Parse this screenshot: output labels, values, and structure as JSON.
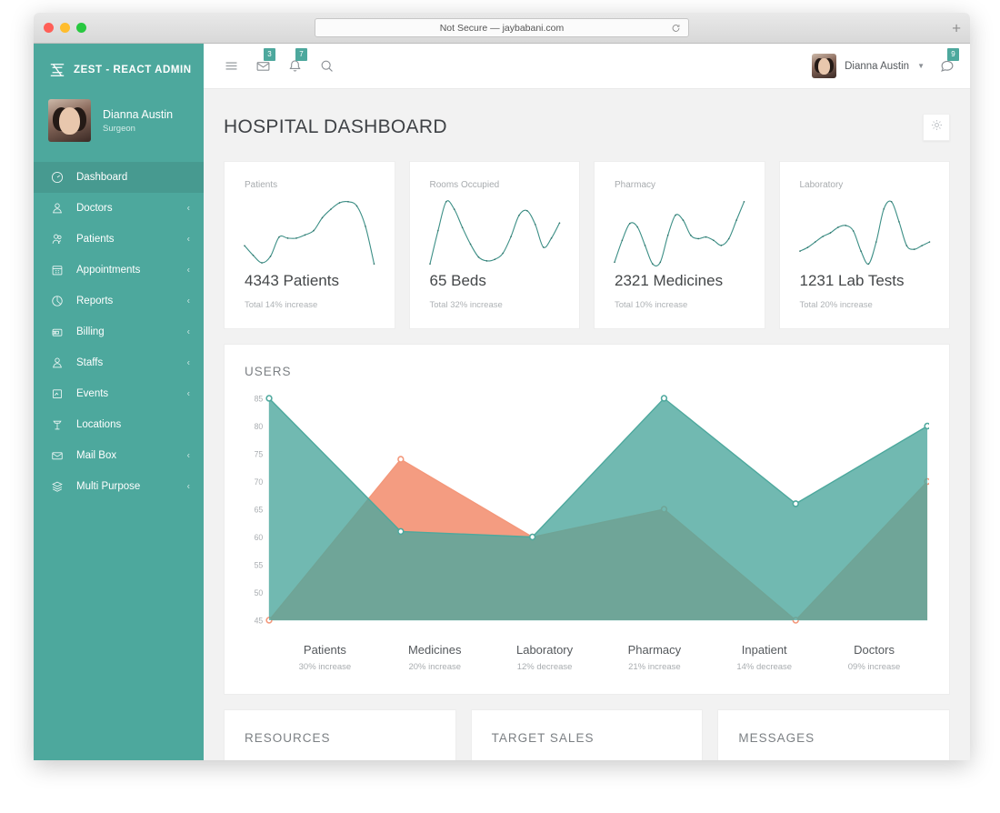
{
  "browser": {
    "url_text": "Not Secure — jaybabani.com",
    "reload_icon": "reload-icon",
    "newtab_label": "+"
  },
  "sidebar": {
    "brand": "ZEST - REACT ADMIN",
    "brand_logo_glyph": "Z",
    "profile": {
      "name": "Dianna Austin",
      "role": "Surgeon"
    },
    "items": [
      {
        "label": "Dashboard",
        "icon": "dashboard-icon",
        "active": true,
        "caret": ""
      },
      {
        "label": "Doctors",
        "icon": "doctor-icon",
        "active": false,
        "caret": "‹"
      },
      {
        "label": "Patients",
        "icon": "patients-icon",
        "active": false,
        "caret": "‹"
      },
      {
        "label": "Appointments",
        "icon": "calendar-icon",
        "active": false,
        "caret": "‹"
      },
      {
        "label": "Reports",
        "icon": "pie-chart-icon",
        "active": false,
        "caret": "‹"
      },
      {
        "label": "Billing",
        "icon": "wallet-icon",
        "active": false,
        "caret": "‹"
      },
      {
        "label": "Staffs",
        "icon": "staff-icon",
        "active": false,
        "caret": "‹"
      },
      {
        "label": "Events",
        "icon": "events-icon",
        "active": false,
        "caret": "‹"
      },
      {
        "label": "Locations",
        "icon": "location-pin-icon",
        "active": false,
        "caret": ""
      },
      {
        "label": "Mail Box",
        "icon": "mail-icon",
        "active": false,
        "caret": "‹"
      },
      {
        "label": "Multi Purpose",
        "icon": "layers-icon",
        "active": false,
        "caret": "‹"
      }
    ]
  },
  "topbar": {
    "menu_icon": "hamburger-icon",
    "mail_icon": "mail-icon",
    "mail_badge": "3",
    "bell_icon": "bell-icon",
    "bell_badge": "7",
    "search_icon": "search-icon",
    "user_name": "Dianna Austin",
    "chat_icon": "chat-icon",
    "chat_badge": "9"
  },
  "page": {
    "title": "HOSPITAL DASHBOARD",
    "settings_icon": "gear-icon"
  },
  "stats": [
    {
      "label": "Patients",
      "value": "4343 Patients",
      "sub": "Total 14% increase",
      "spark": [
        42,
        33,
        26,
        32,
        50,
        49,
        49,
        52,
        56,
        68,
        76,
        82,
        83,
        79,
        60,
        25
      ]
    },
    {
      "label": "Rooms Occupied",
      "value": "65 Beds",
      "sub": "Total 32% increase",
      "spark": [
        8,
        52,
        90,
        80,
        56,
        34,
        17,
        12,
        14,
        22,
        44,
        72,
        78,
        60,
        30,
        42,
        62
      ]
    },
    {
      "label": "Pharmacy",
      "value": "2321 Medicines",
      "sub": "Total 10% increase",
      "spark": [
        16,
        42,
        62,
        58,
        36,
        14,
        16,
        48,
        72,
        66,
        48,
        44,
        46,
        42,
        36,
        44,
        66,
        88
      ]
    },
    {
      "label": "Laboratory",
      "value": "1231 Lab Tests",
      "sub": "Total 20% increase",
      "spark": [
        30,
        34,
        40,
        46,
        50,
        56,
        58,
        52,
        30,
        16,
        40,
        76,
        84,
        62,
        36,
        32,
        36,
        40
      ]
    }
  ],
  "users_card": {
    "title": "USERS"
  },
  "chart_data": {
    "type": "area",
    "title": "USERS",
    "categories": [
      "Patients",
      "Medicines",
      "Laboratory",
      "Pharmacy",
      "Inpatient",
      "Doctors"
    ],
    "series": [
      {
        "name": "Teal Series",
        "color": "#4da89d",
        "values": [
          85,
          61,
          60,
          85,
          66,
          80
        ]
      },
      {
        "name": "Orange Series",
        "color": "#f3977a",
        "values": [
          45,
          74,
          60,
          65,
          45,
          70
        ]
      }
    ],
    "ylim": [
      45,
      85
    ],
    "yticks": [
      45,
      50,
      55,
      60,
      65,
      70,
      75,
      80,
      85
    ],
    "xlabel": "",
    "ylabel": "",
    "grid": false,
    "legend": "none",
    "annotations": [
      {
        "category": "Patients",
        "text": "30% increase"
      },
      {
        "category": "Medicines",
        "text": "20% increase"
      },
      {
        "category": "Laboratory",
        "text": "12% decrease"
      },
      {
        "category": "Pharmacy",
        "text": "21% increase"
      },
      {
        "category": "Inpatient",
        "text": "14% decrease"
      },
      {
        "category": "Doctors",
        "text": "09% increase"
      }
    ]
  },
  "bottom_cards": [
    {
      "title": "RESOURCES"
    },
    {
      "title": "TARGET SALES"
    },
    {
      "title": "MESSAGES"
    }
  ],
  "colors": {
    "brand_teal": "#4da89d",
    "active_teal": "#479a90",
    "orange": "#f3977a",
    "page_bg": "#f2f2f2"
  }
}
